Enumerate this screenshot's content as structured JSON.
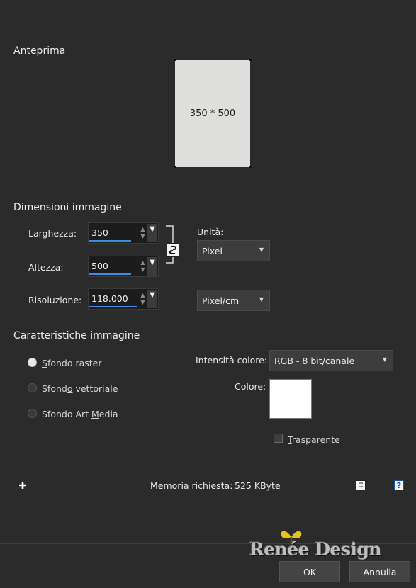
{
  "preview": {
    "title": "Anteprima",
    "size_label": "350 * 500"
  },
  "dimensions": {
    "title": "Dimensioni immagine",
    "width_label": "Larghezza:",
    "width_value": "350",
    "height_label": "Altezza:",
    "height_value": "500",
    "resolution_label": "Risoluzione:",
    "resolution_value": "118.000",
    "units_label": "Unità:",
    "units_value": "Pixel",
    "resolution_units_value": "Pixel/cm"
  },
  "characteristics": {
    "title": "Caratteristiche immagine",
    "options": [
      {
        "pre": "",
        "ul": "S",
        "post": "fondo raster",
        "selected": true
      },
      {
        "pre": "Sfond",
        "ul": "o",
        "post": " vettoriale",
        "selected": false
      },
      {
        "pre": "Sfondo Art ",
        "ul": "M",
        "post": "edia",
        "selected": false
      }
    ],
    "color_depth_label": "Intensità colore:",
    "color_depth_value": "RGB - 8 bit/canale",
    "color_label": "Colore:",
    "color_value": "#ffffff",
    "transparent_pre": "",
    "transparent_ul": "T",
    "transparent_post": "rasparente",
    "transparent_checked": false
  },
  "footer": {
    "memory_label": "Memoria richiesta:",
    "memory_value": "525 KByte",
    "watermark": "Renée Design",
    "ok_label": "OK",
    "cancel_label": "Annulla"
  }
}
